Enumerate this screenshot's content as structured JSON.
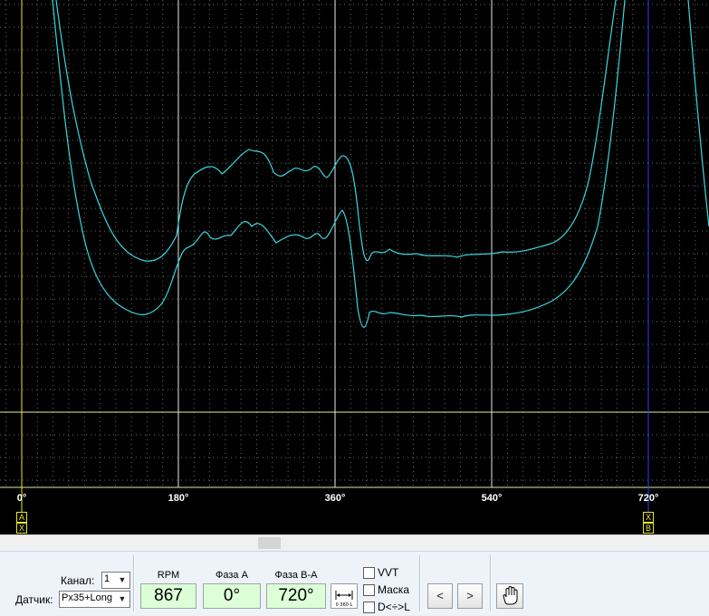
{
  "scope": {
    "x_ticks": [
      "0°",
      "180°",
      "360°",
      "540°",
      "720°"
    ],
    "cursor_a_marks": [
      "A",
      "X"
    ],
    "cursor_b_marks": [
      "X",
      "B"
    ],
    "colors": {
      "background": "#000000",
      "trace": "#3ad8e0",
      "cursor_a": "#e8e820",
      "cursor_b": "#3a3aff",
      "reference_line": "#e8e8a0",
      "grid_dots": "#6a6a6a",
      "major_grid": "#e8e8e8"
    }
  },
  "controls": {
    "channel_label": "Канал:",
    "channel_value": "1",
    "sensor_label": "Датчик:",
    "sensor_value": "Px35+Long",
    "rpm_label": "RPM",
    "rpm_value": "867",
    "phase_a_label": "Фаза A",
    "phase_a_value": "0°",
    "phase_ba_label": "Фаза B-A",
    "phase_ba_value": "720°",
    "range_icon_text": "0 360 L",
    "vvt_label": "VVT",
    "mask_label": "Маска",
    "dl_label": "D<÷>L",
    "prev_label": "<",
    "next_label": ">"
  }
}
